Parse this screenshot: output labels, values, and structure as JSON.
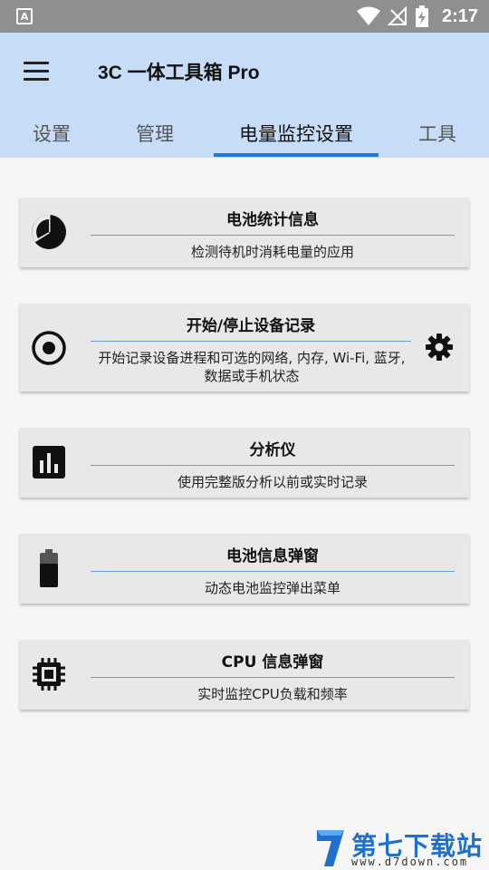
{
  "status_bar": {
    "notification_icon": "A",
    "time": "2:17",
    "icons": [
      "wifi-icon",
      "signal-off-icon",
      "battery-charging-icon"
    ]
  },
  "app_bar": {
    "title": "3C 一体工具箱 Pro",
    "menu_icon": "hamburger-menu-icon"
  },
  "tabs": [
    {
      "label": "设置",
      "active": false
    },
    {
      "label": "管理",
      "active": false
    },
    {
      "label": "电量监控设置",
      "active": true
    },
    {
      "label": "工具",
      "active": false
    }
  ],
  "accent_color": "#1f7ad8",
  "cards": [
    {
      "title": "电池统计信息",
      "description": "检测待机时消耗电量的应用",
      "icon": "pie-chart-icon"
    },
    {
      "title": "开始/停止设备记录",
      "description_line1": "开始记录设备进程和可选的网络, 内存, Wi-Fi, 蓝牙,",
      "description_line2": "数据或手机状态",
      "icon": "record-icon",
      "action_icon": "gear-icon"
    },
    {
      "title": "分析仪",
      "description": "使用完整版分析以前或实时记录",
      "icon": "bar-chart-icon"
    },
    {
      "title": "电池信息弹窗",
      "description": "动态电池监控弹出菜单",
      "icon": "battery-icon"
    },
    {
      "title": "CPU 信息弹窗",
      "description": "实时监控CPU负载和频率",
      "icon": "cpu-chip-icon"
    }
  ],
  "watermark": {
    "text": "第七下载站",
    "url": "www.d7down.com"
  }
}
